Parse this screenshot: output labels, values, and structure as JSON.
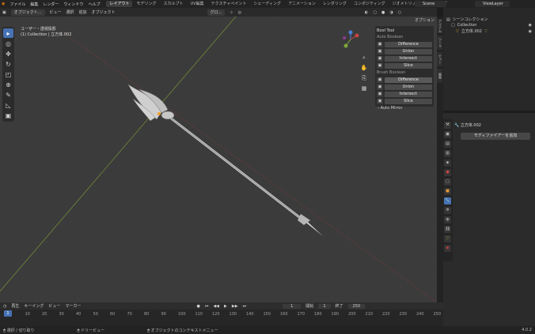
{
  "menu": [
    "ファイル",
    "編集",
    "レンダー",
    "ウィンドウ",
    "ヘルプ"
  ],
  "tabs": [
    "レイアウト",
    "モデリング",
    "スカルプト",
    "UV編集",
    "テクスチャペイント",
    "シェーディング",
    "アニメーション",
    "レンダリング",
    "コンポジティング",
    "ジオメトリノード",
    "スクリプ"
  ],
  "scene": "Scene",
  "view_layer": "ViewLayer",
  "vp_header": {
    "mode": "オブジェクト...",
    "view": "ビュー",
    "select": "選択",
    "add": "追加",
    "object": "オブジェクト",
    "transform": "グロ..."
  },
  "vp_info": {
    "line1": "ユーザー・透視投影",
    "line2": "(1) Collection | 立方体.002"
  },
  "options_label": "オプション",
  "bool_panel": {
    "title": "Bool Tool",
    "auto_title": "Auto Boolean",
    "auto": [
      "Difference",
      "Union",
      "Intersect",
      "Slice"
    ],
    "brush_title": "Brush Boolean",
    "brush": [
      "Difference",
      "Union",
      "Intersect",
      "Slice"
    ]
  },
  "auto_mirror": "Auto Mirror",
  "side_tabs": [
    "アイテム",
    "ツール",
    "ビュー",
    "編集"
  ],
  "outliner": {
    "root": "シーンコレクション",
    "collection": "Collection",
    "object": "立方体.002"
  },
  "props": {
    "object_name": "立方体.002",
    "add_modifier": "モディファイアーを追加"
  },
  "timeline": {
    "menus": [
      "再生",
      "キーイング",
      "ビュー",
      "マーカー"
    ],
    "current": "1",
    "start_label": "開始",
    "start": "1",
    "end_label": "終了",
    "end": "250",
    "ticks": [
      "0",
      "10",
      "20",
      "30",
      "40",
      "50",
      "60",
      "70",
      "80",
      "90",
      "100",
      "110",
      "120",
      "130",
      "140",
      "150",
      "160",
      "170",
      "180",
      "190",
      "200",
      "210",
      "220",
      "230",
      "240",
      "250"
    ]
  },
  "status": {
    "select": "選択 / 切り取り",
    "pan": "ドリービュー",
    "context": "オブジェクトのコンテキストメニュー",
    "version": "4.0.2"
  }
}
